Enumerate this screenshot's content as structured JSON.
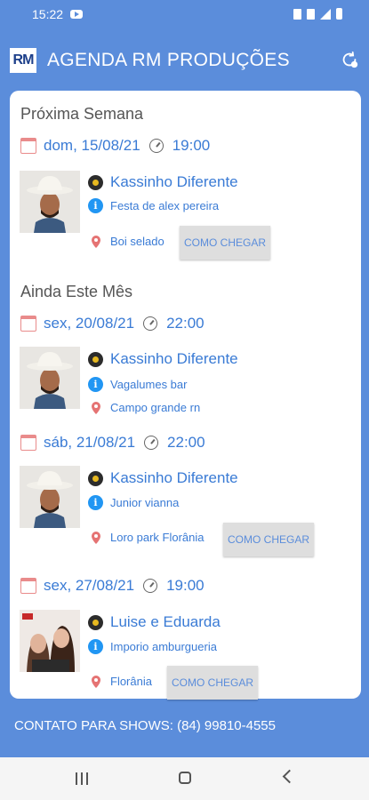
{
  "status_bar": {
    "time": "15:22"
  },
  "app": {
    "logo_text": "RM",
    "title": "AGENDA RM PRODUÇÕES"
  },
  "sections": [
    {
      "title": "Próxima Semana",
      "events": [
        {
          "date": "dom, 15/08/21",
          "time": "19:00",
          "artist": "Kassinho Diferente",
          "venue": "Festa de alex pereira",
          "place": "Boi selado",
          "button": "COMO CHEGAR"
        }
      ]
    },
    {
      "title": "Ainda Este Mês",
      "events": [
        {
          "date": "sex, 20/08/21",
          "time": "22:00",
          "artist": "Kassinho Diferente",
          "venue": "Vagalumes bar",
          "place": "Campo grande rn"
        },
        {
          "date": "sáb, 21/08/21",
          "time": "22:00",
          "artist": "Kassinho Diferente",
          "venue": "Junior vianna",
          "place": "Loro park Florânia",
          "button": "COMO CHEGAR"
        },
        {
          "date": "sex, 27/08/21",
          "time": "19:00",
          "artist": "Luise e Eduarda",
          "venue": "Imporio amburgueria",
          "place": "Florânia",
          "button": "COMO CHEGAR"
        }
      ]
    }
  ],
  "footer": {
    "contact": "CONTATO PARA SHOWS: (84) 99810-4555"
  },
  "colors": {
    "primary": "#5b8ddb",
    "link": "#3a7bd5",
    "info": "#2196f3",
    "pin": "#e57373"
  }
}
